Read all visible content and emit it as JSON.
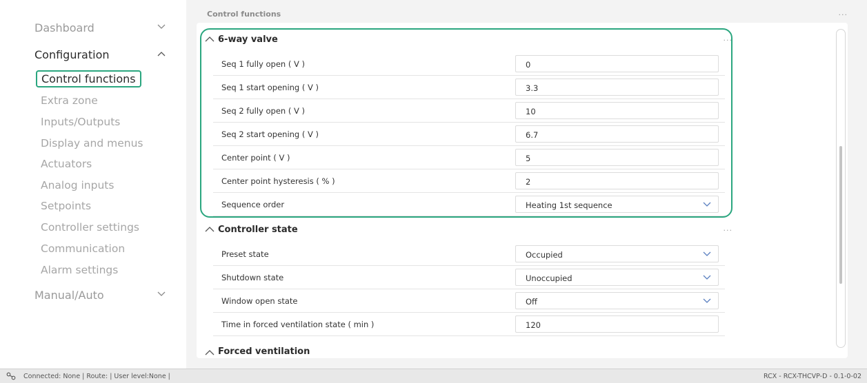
{
  "sidebar": {
    "top_items": [
      {
        "label": "Dashboard",
        "expanded": false
      },
      {
        "label": "Configuration",
        "expanded": true
      },
      {
        "label": "Manual/Auto",
        "expanded": false
      }
    ],
    "sub_items": [
      "Control functions",
      "Extra zone",
      "Inputs/Outputs",
      "Display and menus",
      "Actuators",
      "Analog inputs",
      "Setpoints",
      "Controller settings",
      "Communication",
      "Alarm settings"
    ],
    "selected": "Control functions"
  },
  "main": {
    "title": "Control functions",
    "menu_dots": "...",
    "sections": [
      {
        "title": "6-way valve",
        "rows": [
          {
            "label": "Seq 1 fully open ( V )",
            "value": "0",
            "type": "input"
          },
          {
            "label": "Seq 1 start opening ( V )",
            "value": "3.3",
            "type": "input"
          },
          {
            "label": "Seq 2 fully open ( V )",
            "value": "10",
            "type": "input"
          },
          {
            "label": "Seq 2 start opening ( V )",
            "value": "6.7",
            "type": "input"
          },
          {
            "label": "Center point ( V )",
            "value": "5",
            "type": "input"
          },
          {
            "label": "Center point hysteresis ( % )",
            "value": "2",
            "type": "input"
          },
          {
            "label": "Sequence order",
            "value": "Heating 1st sequence",
            "type": "select"
          }
        ]
      },
      {
        "title": "Controller state",
        "rows": [
          {
            "label": "Preset state",
            "value": "Occupied",
            "type": "select"
          },
          {
            "label": "Shutdown state",
            "value": "Unoccupied",
            "type": "select"
          },
          {
            "label": "Window open state",
            "value": "Off",
            "type": "select"
          },
          {
            "label": "Time in forced ventilation state ( min )",
            "value": "120",
            "type": "input"
          }
        ]
      },
      {
        "title": "Forced ventilation",
        "rows": []
      }
    ]
  },
  "status": {
    "left": "Connected: None | Route: | User level:None |",
    "right": "RCX - RCX-THCVP-D - 0.1-0-02"
  },
  "colors": {
    "accent": "#2aa67f"
  }
}
